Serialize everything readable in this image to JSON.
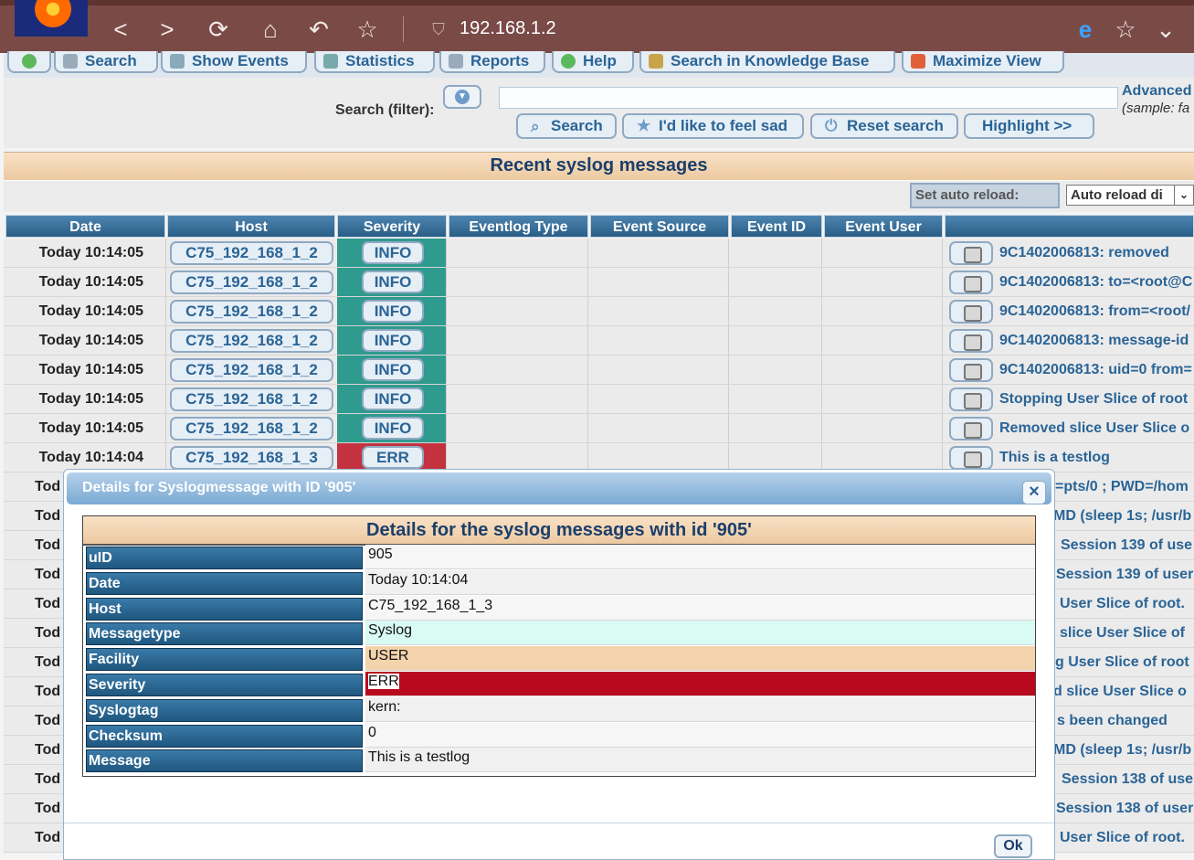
{
  "browser": {
    "address": "192.168.1.2",
    "nav_icons": [
      "back-icon",
      "forward-icon",
      "reload-icon",
      "home-icon",
      "undo-icon",
      "star-icon"
    ],
    "glyphs": {
      "back": "<",
      "forward": ">",
      "reload": "⟳",
      "home": "⌂",
      "undo": "↶",
      "star": "☆",
      "edge": "e",
      "menu": "⌄"
    }
  },
  "menu": {
    "search": "Search",
    "show_events": "Show Events",
    "statistics": "Statistics",
    "reports": "Reports",
    "help": "Help",
    "knowledge": "Search in Knowledge Base",
    "maximize": "Maximize View"
  },
  "search": {
    "label": "Search (filter):",
    "advanced": "Advanced",
    "sample": "(sample: fa",
    "btn_search": "Search",
    "btn_sad": "I'd like to feel sad",
    "btn_reset": "Reset search",
    "btn_highlight": "Highlight >>"
  },
  "recent": {
    "title": "Recent syslog messages",
    "set_reload": "Set auto reload:",
    "reload_option": "Auto reload di"
  },
  "table": {
    "headers": [
      "Date",
      "Host",
      "Severity",
      "Eventlog Type",
      "Event Source",
      "Event ID",
      "Event User"
    ],
    "rows": [
      {
        "date": "Today 10:14:05",
        "host": "C75_192_168_1_2",
        "severity": "INFO",
        "message": "9C1402006813: removed"
      },
      {
        "date": "Today 10:14:05",
        "host": "C75_192_168_1_2",
        "severity": "INFO",
        "message": "9C1402006813: to=<root@C"
      },
      {
        "date": "Today 10:14:05",
        "host": "C75_192_168_1_2",
        "severity": "INFO",
        "message": "9C1402006813: from=<root/"
      },
      {
        "date": "Today 10:14:05",
        "host": "C75_192_168_1_2",
        "severity": "INFO",
        "message": "9C1402006813: message-id"
      },
      {
        "date": "Today 10:14:05",
        "host": "C75_192_168_1_2",
        "severity": "INFO",
        "message": "9C1402006813: uid=0 from="
      },
      {
        "date": "Today 10:14:05",
        "host": "C75_192_168_1_2",
        "severity": "INFO",
        "message": "Stopping User Slice of root"
      },
      {
        "date": "Today 10:14:05",
        "host": "C75_192_168_1_2",
        "severity": "INFO",
        "message": "Removed slice User Slice o"
      },
      {
        "date": "Today 10:14:04",
        "host": "C75_192_168_1_3",
        "severity": "ERR",
        "message": "This is a testlog"
      }
    ],
    "hidden_rows": [
      {
        "date": "Tod",
        "message": "=pts/0 ; PWD=/hom"
      },
      {
        "date": "Tod",
        "message": "MD (sleep 1s; /usr/b"
      },
      {
        "date": "Tod",
        "message": "Session 139 of use"
      },
      {
        "date": "Tod",
        "message": "Session 139 of user"
      },
      {
        "date": "Tod",
        "message": "User Slice of root."
      },
      {
        "date": "Tod",
        "message": "slice User Slice of"
      },
      {
        "date": "Tod",
        "message": "g User Slice of root"
      },
      {
        "date": "Tod",
        "message": "d slice User Slice o"
      },
      {
        "date": "Tod",
        "message": "s been changed"
      },
      {
        "date": "Tod",
        "message": "MD (sleep 1s; /usr/b"
      },
      {
        "date": "Tod",
        "message": "Session 138 of use"
      },
      {
        "date": "Tod",
        "message": "Session 138 of user"
      },
      {
        "date": "Tod",
        "message": "User Slice of root."
      }
    ]
  },
  "dialog": {
    "title": "Details for Syslogmessage with ID '905'",
    "close": "×",
    "heading": "Details for the syslog messages with id '905'",
    "fields": [
      {
        "label": "uID",
        "value": "905"
      },
      {
        "label": "Date",
        "value": "Today 10:14:04"
      },
      {
        "label": "Host",
        "value": "C75_192_168_1_3"
      },
      {
        "label": "Messagetype",
        "value": "Syslog"
      },
      {
        "label": "Facility",
        "value": "USER"
      },
      {
        "label": "Severity",
        "value": "ERR"
      },
      {
        "label": "Syslogtag",
        "value": "kern:"
      },
      {
        "label": "Checksum",
        "value": "0"
      },
      {
        "label": "Message",
        "value": "This is a testlog"
      }
    ],
    "ok": "Ok"
  },
  "colors": {
    "info": "#2f9a8e",
    "err": "#c4323f",
    "err_value": "#b8091f",
    "messagetype_value": "#d8fbf3",
    "facility_value": "#f3d3ab",
    "link": "#2a6496"
  }
}
